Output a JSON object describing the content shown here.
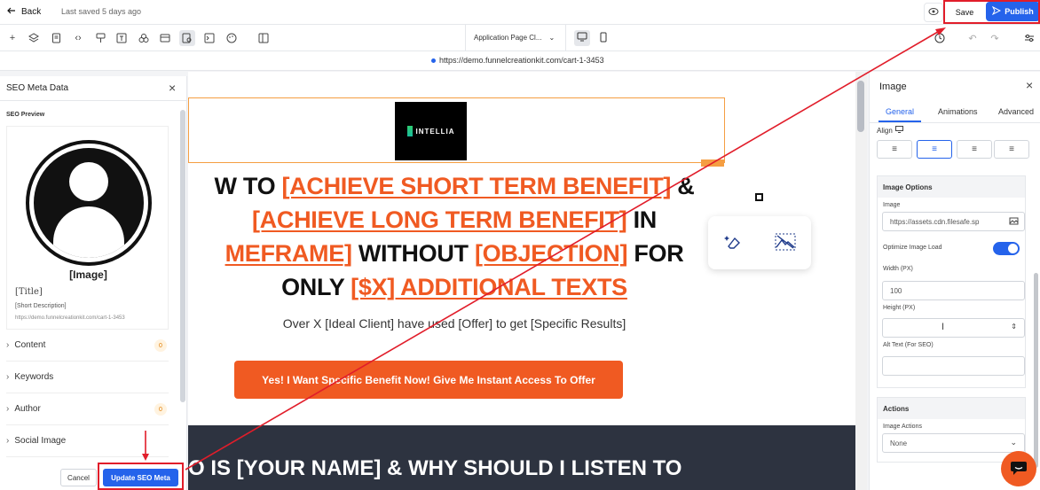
{
  "topbar": {
    "back_label": "Back",
    "saved_text": "Last saved 5 days ago",
    "save_label": "Save",
    "publish_label": "Publish"
  },
  "toolbar": {
    "page_select": "Application Page Cl..."
  },
  "url": "https://demo.funnelcreationkit.com/cart-1-3453",
  "seo": {
    "title": "SEO Meta Data",
    "preview_label": "SEO Preview",
    "preview_image": "[Image]",
    "preview_title": "[Title]",
    "preview_desc": "[Short Description]",
    "preview_url": "https://demo.funnelcreationkit.com/cart-1-3453",
    "sections": [
      {
        "label": "Content",
        "count": "0"
      },
      {
        "label": "Keywords",
        "count": ""
      },
      {
        "label": "Author",
        "count": "0"
      },
      {
        "label": "Social Image",
        "count": ""
      }
    ],
    "cancel_label": "Cancel",
    "update_label": "Update SEO Meta"
  },
  "canvas": {
    "logo_text": "INTELLIA",
    "headline": {
      "l1a": "W TO ",
      "l1b": "[ACHIEVE SHORT TERM BENEFIT]",
      "l1c": " &",
      "l2a": "[ACHIEVE LONG TERM BENEFIT]",
      "l2b": " IN",
      "l3a": "MEFRAME]",
      "l3b": " WITHOUT ",
      "l3c": "[OBJECTION]",
      "l3d": " FOR",
      "l4a": "ONLY ",
      "l4b": "[$X] ADDITIONAL TEXTS"
    },
    "subhead": "Over X [Ideal Client] have used [Offer] to get [Specific Results]",
    "cta": "Yes! I Want Specific Benefit Now! Give Me Instant Access To Offer",
    "dark_heading": "O IS [YOUR NAME] & WHY SHOULD I LISTEN TO"
  },
  "image_panel": {
    "title": "Image",
    "tabs": [
      "General",
      "Animations",
      "Advanced"
    ],
    "align_label": "Align",
    "options_title": "Image Options",
    "image_label": "Image",
    "image_value": "https://assets.cdn.filesafe.sp",
    "optimize_label": "Optimize Image Load",
    "width_label": "Width (PX)",
    "width_value": "100",
    "height_label": "Height (PX)",
    "height_value": "",
    "alt_label": "Alt Text (For SEO)",
    "alt_value": "",
    "actions_title": "Actions",
    "image_actions_label": "Image Actions",
    "image_actions_value": "None"
  },
  "colors": {
    "accent": "#2563eb",
    "brand_orange": "#f05a22",
    "annotation_red": "#e11d2a"
  }
}
